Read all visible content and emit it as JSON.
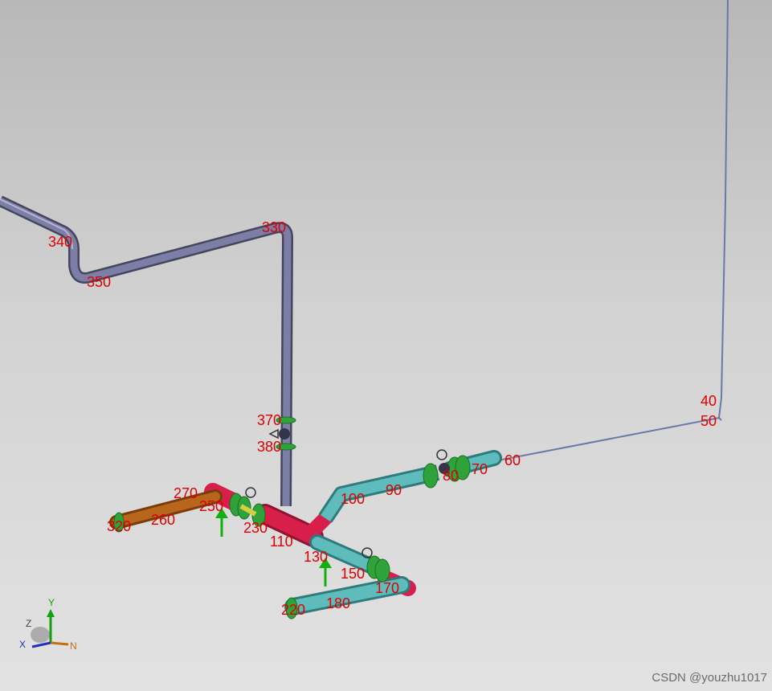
{
  "node_labels": [
    {
      "id": "n40",
      "text": "40"
    },
    {
      "id": "n50",
      "text": "50"
    },
    {
      "id": "n60",
      "text": "60"
    },
    {
      "id": "n70",
      "text": "70"
    },
    {
      "id": "n80",
      "text": "80"
    },
    {
      "id": "n90",
      "text": "90"
    },
    {
      "id": "n100",
      "text": "100"
    },
    {
      "id": "n110",
      "text": "110"
    },
    {
      "id": "n130",
      "text": "130"
    },
    {
      "id": "n150",
      "text": "150"
    },
    {
      "id": "n170",
      "text": "170"
    },
    {
      "id": "n180",
      "text": "180"
    },
    {
      "id": "n220",
      "text": "220"
    },
    {
      "id": "n230",
      "text": "230"
    },
    {
      "id": "n250",
      "text": "250"
    },
    {
      "id": "n260",
      "text": "260"
    },
    {
      "id": "n270",
      "text": "270"
    },
    {
      "id": "n320",
      "text": "320"
    },
    {
      "id": "n330",
      "text": "330"
    },
    {
      "id": "n340",
      "text": "340"
    },
    {
      "id": "n350",
      "text": "350"
    },
    {
      "id": "n370",
      "text": "370"
    },
    {
      "id": "n380",
      "text": "380"
    }
  ],
  "triad": {
    "y": "Y",
    "z": "Z",
    "x": "X",
    "n": "N"
  },
  "watermark": "CSDN @youzhu1017",
  "colors": {
    "pipe_purple": "#6b6c94",
    "pipe_cyan": "#5fbcbc",
    "pipe_red": "#d81e4a",
    "pipe_orange": "#b8661c",
    "flange_green": "#2fa33a",
    "label_red": "#e00000",
    "restraint_green": "#10b010"
  }
}
